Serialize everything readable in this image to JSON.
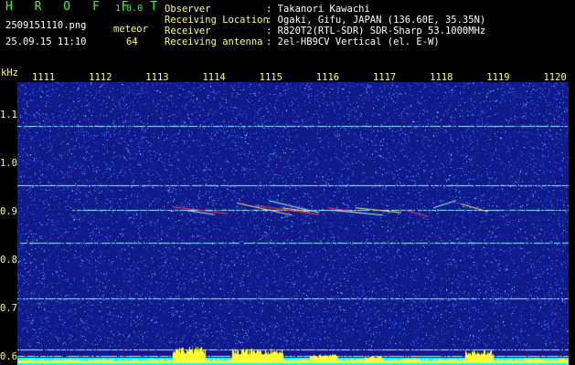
{
  "header": {
    "app_name": "H R O F F T",
    "version": "1.0.0",
    "file_name": "2509151110.png",
    "detection_type": "meteor",
    "datetime": "25.09.15 11:10",
    "count": "64",
    "info": [
      {
        "label": "Observer",
        "value": ": Takanori Kawachi"
      },
      {
        "label": "Receiving Location",
        "value": ": Ogaki, Gifu, JAPAN (136.60E, 35.35N)"
      },
      {
        "label": "Receiver",
        "value": ": R820T2(RTL-SDR) SDR-Sharp 53.1000MHz"
      },
      {
        "label": "Receiving antenna",
        "value": ": 2el-HB9CV Vertical (el. E-W)"
      }
    ]
  },
  "spectrogram": {
    "y_unit": "kHz",
    "y_ticks": [
      "1.1",
      "1.0",
      "0.9",
      "0.8",
      "0.7",
      "0.6"
    ],
    "y_values": [
      1.1,
      1.0,
      0.9,
      0.8,
      0.7,
      0.6
    ],
    "y_range": [
      0.585,
      1.17
    ],
    "x_ticks": [
      "1111",
      "1112",
      "1113",
      "1114",
      "1115",
      "1116",
      "1117",
      "1118",
      "1119",
      "1120"
    ],
    "x_values": [
      1111,
      1112,
      1113,
      1114,
      1115,
      1116,
      1117,
      1118,
      1119,
      1120
    ],
    "x_range": [
      1110.55,
      1120.25
    ],
    "carrier_lines_khz": [
      1.08,
      0.957,
      0.905,
      0.838,
      0.722,
      0.618,
      0.603
    ],
    "colors": {
      "background": "#101a8a",
      "noise": "#3b66ff",
      "carrier": "#8ff0ff",
      "meteor": "#ff3366",
      "baseline": "#00ffff",
      "level": "#ffff33"
    }
  }
}
